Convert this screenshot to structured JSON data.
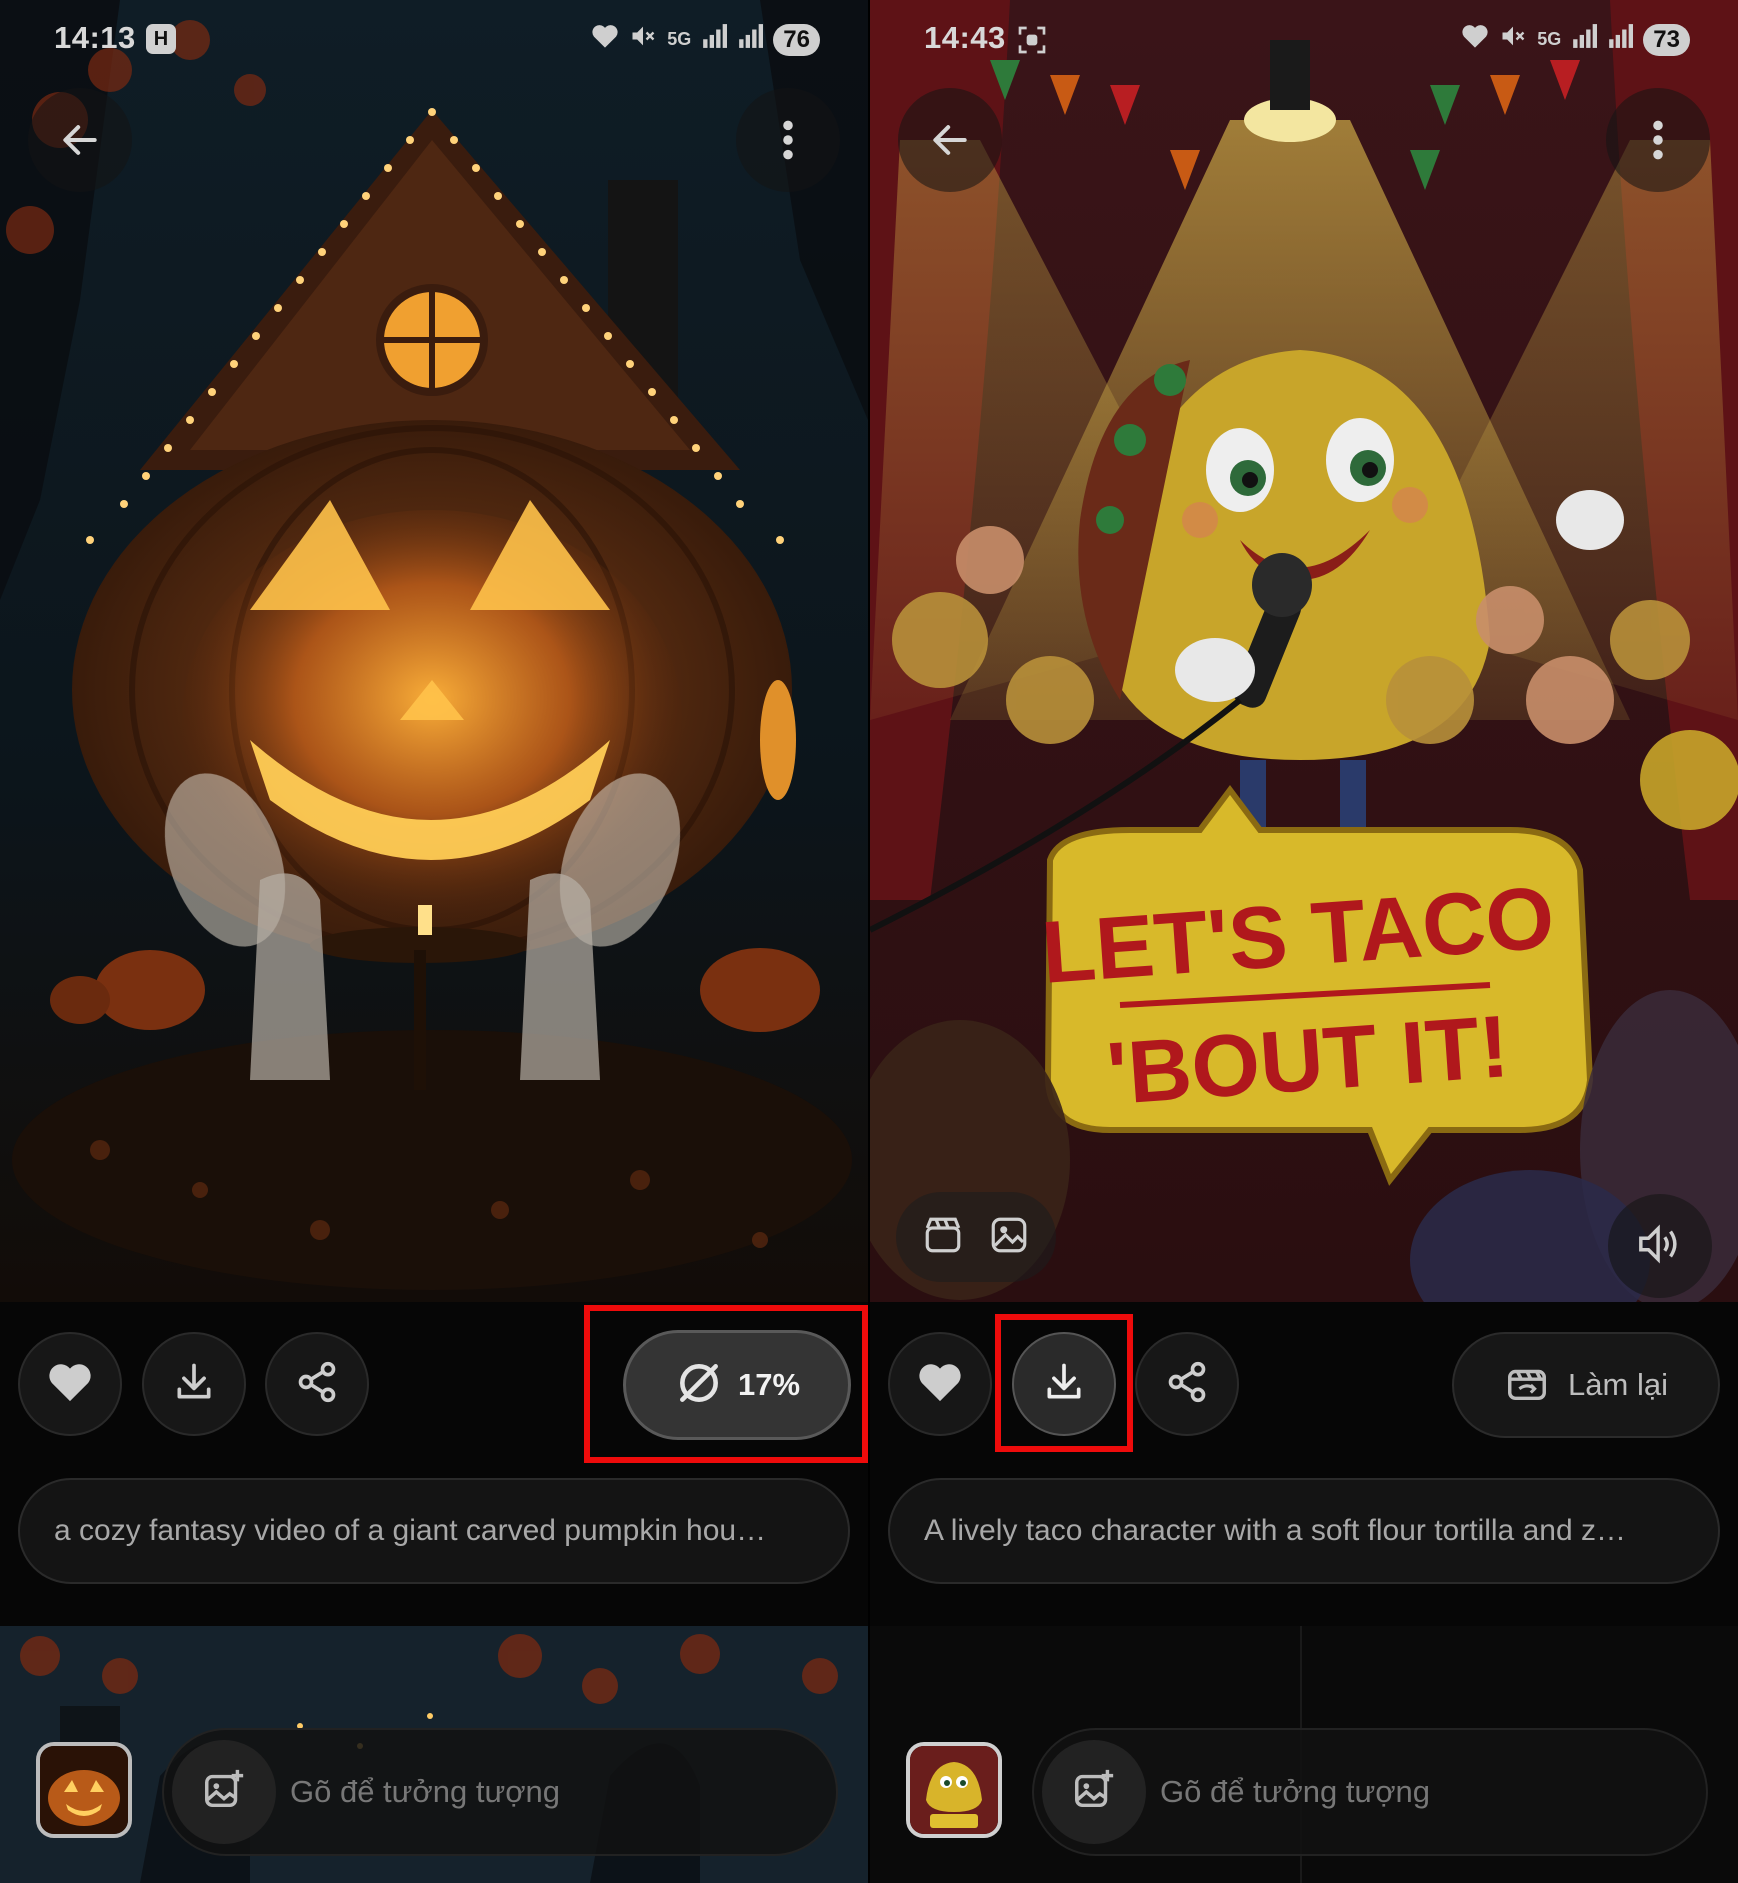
{
  "colors": {
    "highlight": "#ee0b0b",
    "icon": "#d0d0d0",
    "background": "#060606"
  },
  "left": {
    "status": {
      "time": "14:13",
      "carrier_badge": "H",
      "network": "5G",
      "battery": "76",
      "icons": [
        "heart-icon",
        "mute-icon",
        "5g-icon",
        "signal-icon",
        "signal-icon"
      ]
    },
    "toolbar": {
      "back_icon": "arrow-left-icon",
      "menu_icon": "more-vertical-icon"
    },
    "actions": {
      "like_icon": "heart-icon",
      "download_icon": "download-icon",
      "share_icon": "share-icon",
      "progress_text": "17%",
      "progress_icon": "loading-ring-icon",
      "progress_value": 0.17
    },
    "prompt": "a cozy fantasy video of a giant carved pumpkin hou…",
    "compose": {
      "placeholder": "Gõ để tưởng tượng",
      "add_image_icon": "image-plus-icon"
    }
  },
  "right": {
    "status": {
      "time": "14:43",
      "screenshot_icon": "screenshot-icon",
      "network": "5G",
      "battery": "73",
      "icons": [
        "heart-icon",
        "mute-icon",
        "5g-icon",
        "signal-icon",
        "signal-icon"
      ]
    },
    "toolbar": {
      "back_icon": "arrow-left-icon",
      "menu_icon": "more-vertical-icon"
    },
    "poster": {
      "line1": "LET'S TACO",
      "line2": "'BOUT IT!"
    },
    "media_toggle": {
      "video_icon": "video-clapper-icon",
      "image_icon": "image-icon"
    },
    "sound_icon": "volume-icon",
    "actions": {
      "like_icon": "heart-icon",
      "download_icon": "download-icon",
      "share_icon": "share-icon",
      "redo_label": "Làm lại",
      "redo_icon": "redo-video-icon"
    },
    "prompt": "A lively taco character with a soft flour tortilla and z…",
    "compose": {
      "placeholder": "Gõ để tưởng tượng",
      "add_image_icon": "image-plus-icon"
    }
  }
}
